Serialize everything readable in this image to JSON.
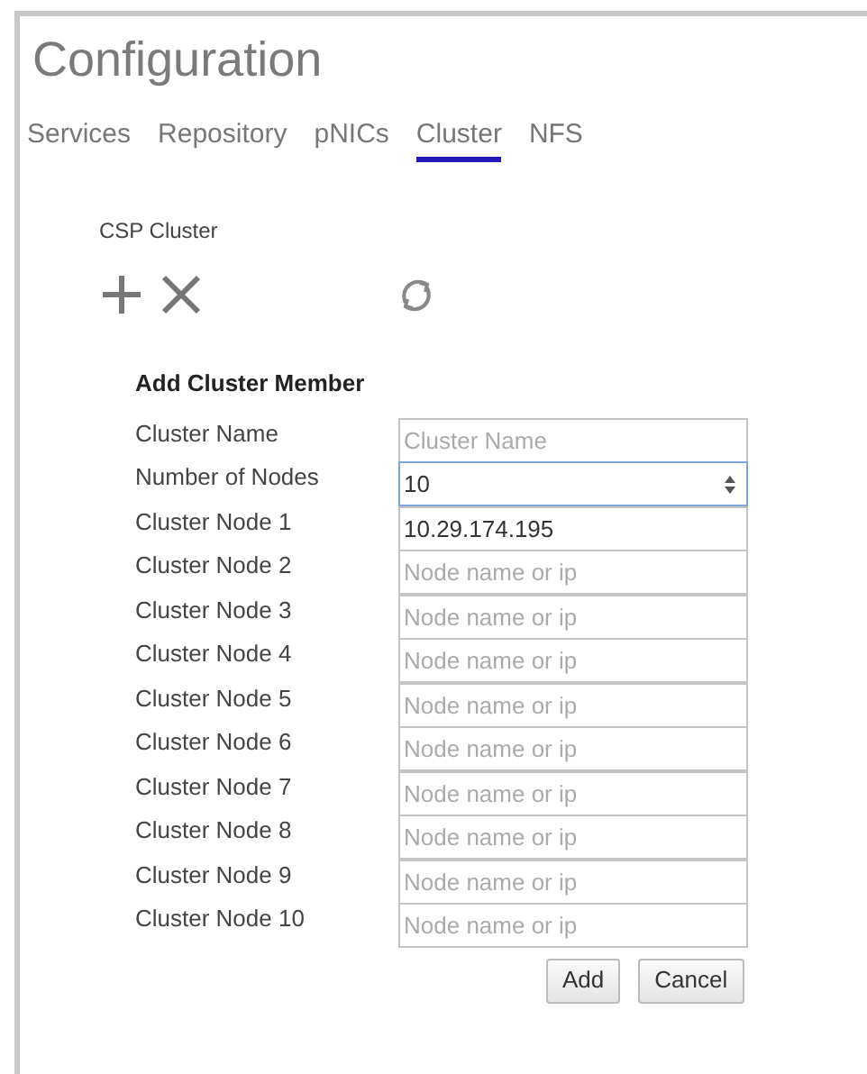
{
  "title": "Configuration",
  "tabs": [
    {
      "label": "Services",
      "selected": false
    },
    {
      "label": "Repository",
      "selected": false
    },
    {
      "label": "pNICs",
      "selected": false
    },
    {
      "label": "Cluster",
      "selected": true
    },
    {
      "label": "NFS",
      "selected": false
    }
  ],
  "section_title": "CSP Cluster",
  "form": {
    "title": "Add Cluster Member",
    "fields": [
      {
        "label": "Cluster Name",
        "kind": "text",
        "placeholder": "Cluster Name",
        "focused": false
      },
      {
        "label": "Number of Nodes",
        "kind": "number",
        "value": "10",
        "focused": true
      },
      {
        "label": "Cluster Node 1",
        "kind": "text",
        "value": "10.29.174.195",
        "focused": false
      },
      {
        "label": "Cluster Node 2",
        "kind": "text",
        "placeholder": "Node name or ip",
        "focused": false
      },
      {
        "label": "Cluster Node 3",
        "kind": "text",
        "placeholder": "Node name or ip",
        "focused": false
      },
      {
        "label": "Cluster Node 4",
        "kind": "text",
        "placeholder": "Node name or ip",
        "focused": false
      },
      {
        "label": "Cluster Node 5",
        "kind": "text",
        "placeholder": "Node name or ip",
        "focused": false
      },
      {
        "label": "Cluster Node 6",
        "kind": "text",
        "placeholder": "Node name or ip",
        "focused": false
      },
      {
        "label": "Cluster Node 7",
        "kind": "text",
        "placeholder": "Node name or ip",
        "focused": false
      },
      {
        "label": "Cluster Node 8",
        "kind": "text",
        "placeholder": "Node name or ip",
        "focused": false
      },
      {
        "label": "Cluster Node 9",
        "kind": "text",
        "placeholder": "Node name or ip",
        "focused": false
      },
      {
        "label": "Cluster Node 10",
        "kind": "text",
        "placeholder": "Node name or ip",
        "focused": false
      }
    ],
    "buttons": [
      "Add",
      "Cancel"
    ]
  }
}
